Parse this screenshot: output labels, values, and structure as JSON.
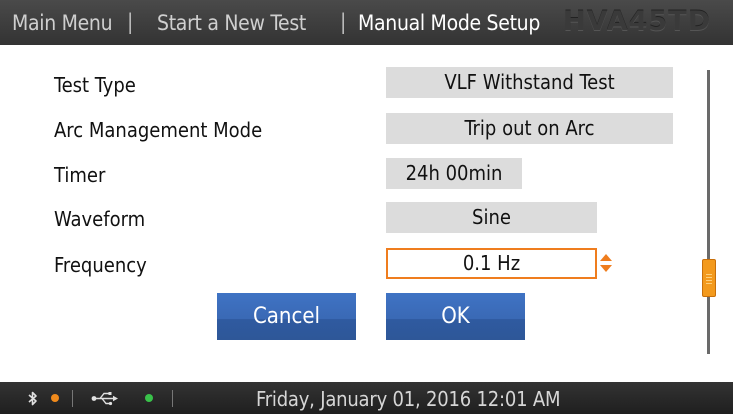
{
  "header": {
    "breadcrumbs": [
      "Main Menu",
      "Start a New Test",
      "Manual Mode Setup"
    ],
    "separator": "|",
    "brand": "HVA45TD"
  },
  "settings": [
    {
      "label": "Test Type",
      "value": "VLF Withstand Test"
    },
    {
      "label": "Arc Management Mode",
      "value": "Trip out on Arc"
    },
    {
      "label": "Timer",
      "value": "24h 00min"
    },
    {
      "label": "Waveform",
      "value": "Sine"
    },
    {
      "label": "Frequency",
      "value": "0.1 Hz"
    }
  ],
  "buttons": {
    "cancel": "Cancel",
    "ok": "OK"
  },
  "status": {
    "datetime": "Friday, January 01, 2016 12:01 AM",
    "bluetooth_icon": "bluetooth-icon",
    "usb_icon": "usb-icon",
    "bluetooth_status_color": "#f08a1c",
    "usb_status_color": "#39c24a"
  },
  "colors": {
    "accent": "#ef7d1e",
    "button": "#3a69b5"
  }
}
